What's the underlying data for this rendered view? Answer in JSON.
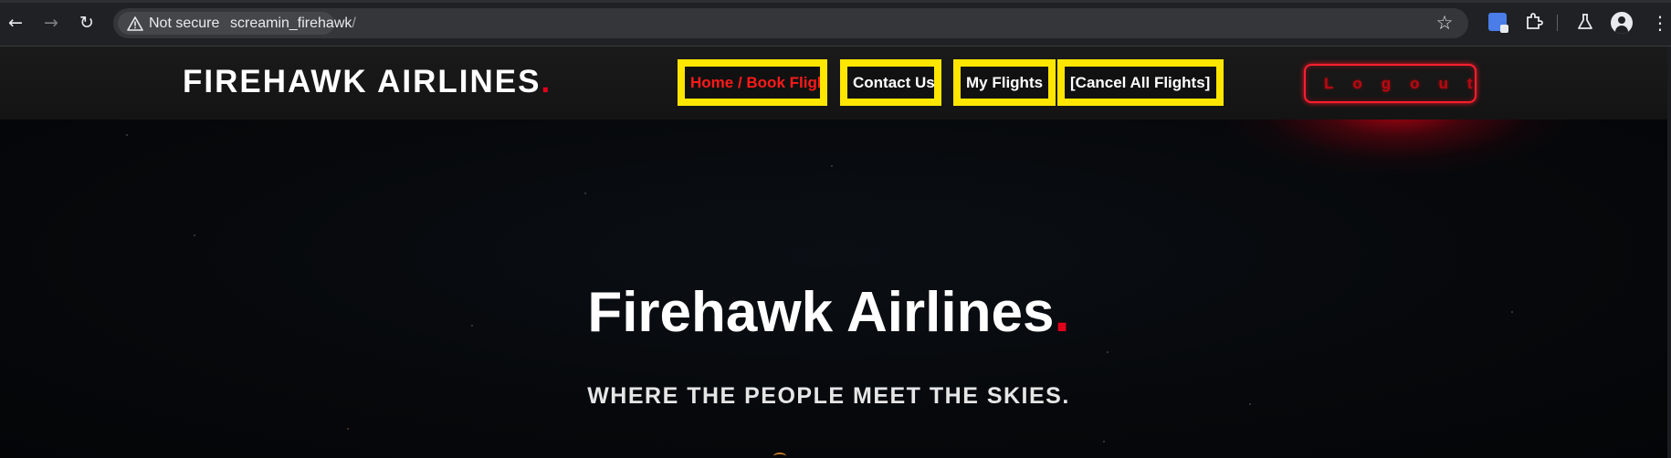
{
  "browser": {
    "back_icon": "arrow-left-icon",
    "forward_icon": "arrow-right-icon",
    "reload_icon": "reload-icon",
    "security_label": "Not secure",
    "url_host": "screamin_firehawk",
    "url_path": "/",
    "bookmark_icon": "star-icon",
    "extensions": [
      "google-translate-icon",
      "puzzle-icon",
      "flask-icon"
    ],
    "profile_icon": "profile-icon",
    "menu_icon": "kebab-icon"
  },
  "header": {
    "brand": "FIREHAWK AIRLINES",
    "brand_dot": ".",
    "nav": [
      {
        "label": "Home / Book Flights",
        "active": true
      },
      {
        "label": "Contact Us",
        "active": false
      },
      {
        "label": "My Flights",
        "active": false
      },
      {
        "label": "[Cancel All Flights]",
        "active": false
      }
    ],
    "logout_label": "Logout"
  },
  "hero": {
    "title": "Firehawk Airlines",
    "title_dot": ".",
    "subtitle": "WHERE THE PEOPLE MEET THE SKIES."
  },
  "colors": {
    "accent_red": "#e3001b",
    "nav_border_yellow": "#ffe600",
    "background": "#05070a"
  }
}
